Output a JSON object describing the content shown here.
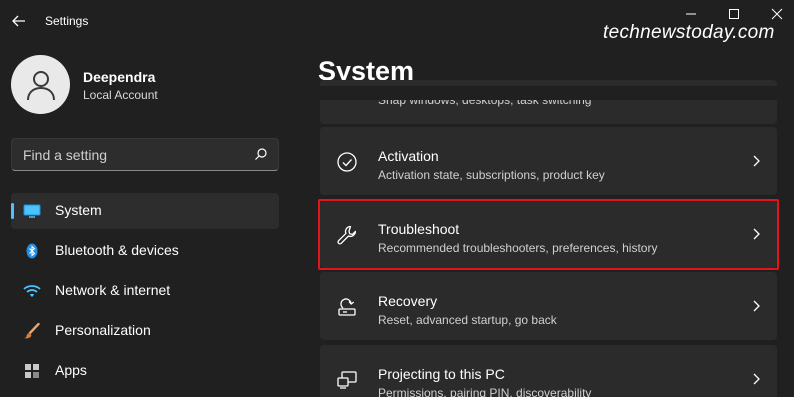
{
  "app": {
    "title": "Settings"
  },
  "watermark": "technewstoday.com",
  "profile": {
    "name": "Deependra",
    "account_type": "Local Account"
  },
  "search": {
    "placeholder": "Find a setting"
  },
  "sidebar": {
    "items": [
      {
        "label": "System",
        "icon": "monitor-icon",
        "active": true
      },
      {
        "label": "Bluetooth & devices",
        "icon": "bluetooth-icon",
        "active": false
      },
      {
        "label": "Network & internet",
        "icon": "wifi-icon",
        "active": false
      },
      {
        "label": "Personalization",
        "icon": "paintbrush-icon",
        "active": false
      },
      {
        "label": "Apps",
        "icon": "apps-icon",
        "active": false
      }
    ]
  },
  "main": {
    "title": "System",
    "partial_card": {
      "subtitle": "Snap windows, desktops, task switching"
    },
    "cards": [
      {
        "title": "Activation",
        "subtitle": "Activation state, subscriptions, product key",
        "icon": "check-circle-icon"
      },
      {
        "title": "Troubleshoot",
        "subtitle": "Recommended troubleshooters, preferences, history",
        "icon": "wrench-icon",
        "highlighted": true
      },
      {
        "title": "Recovery",
        "subtitle": "Reset, advanced startup, go back",
        "icon": "recovery-icon"
      },
      {
        "title": "Projecting to this PC",
        "subtitle": "Permissions, pairing PIN, discoverability",
        "icon": "projector-icon"
      }
    ]
  },
  "colors": {
    "accent": "#4cc2ff",
    "highlight_border": "#e0161c",
    "background": "#202020",
    "card": "#2b2b2b"
  }
}
